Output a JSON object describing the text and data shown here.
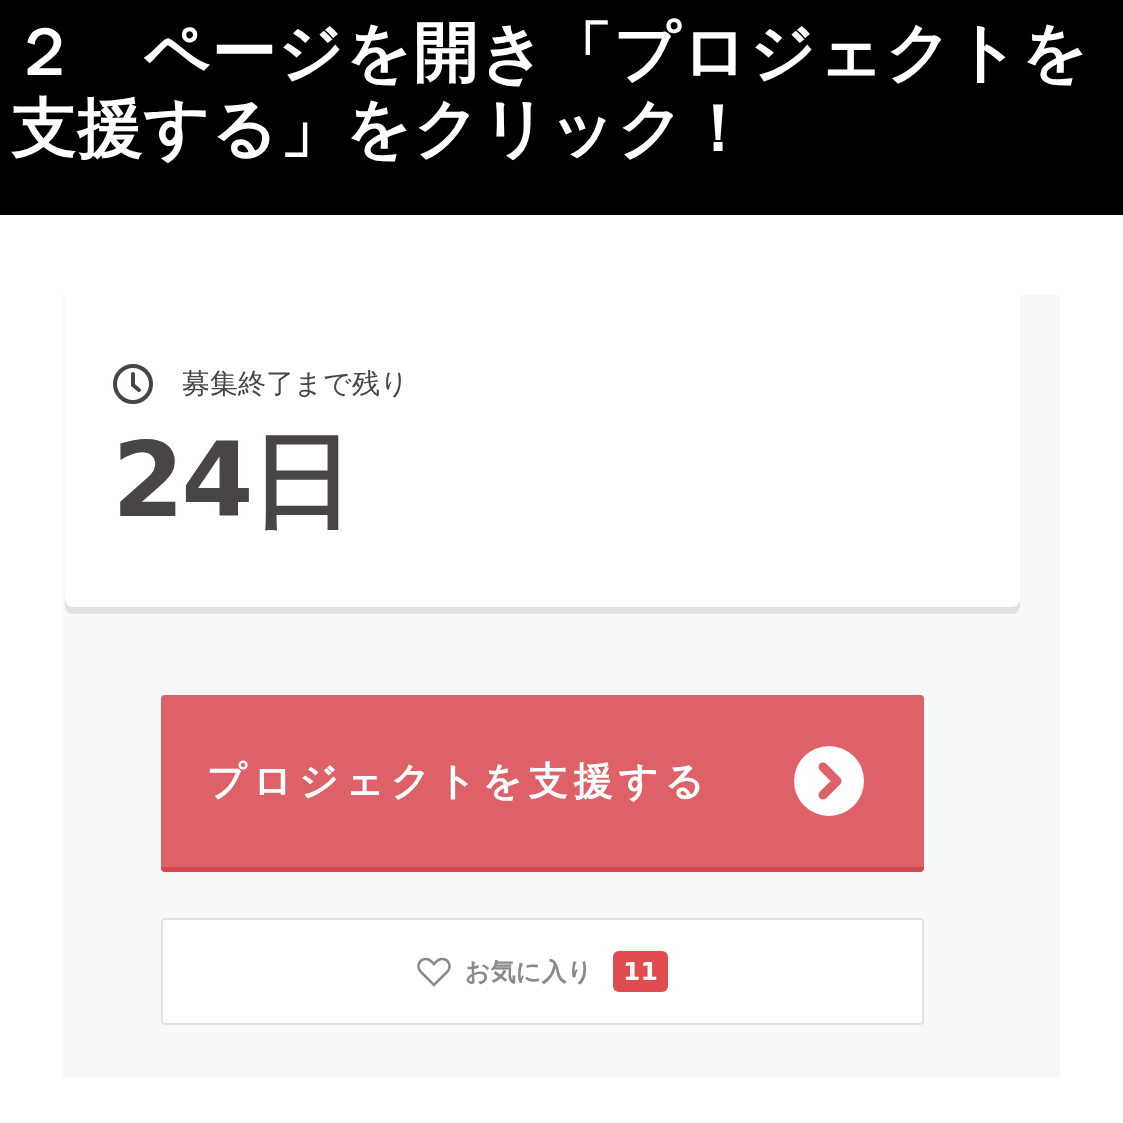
{
  "caption": "２　ページを開き「プロジェクトを支援する」をクリック！",
  "remaining_card": {
    "label": "募集終了まで残り",
    "value": "24日"
  },
  "support_button": {
    "label": "プロジェクトを支援する"
  },
  "favorite_button": {
    "label": "お気に入り",
    "count": "11"
  }
}
